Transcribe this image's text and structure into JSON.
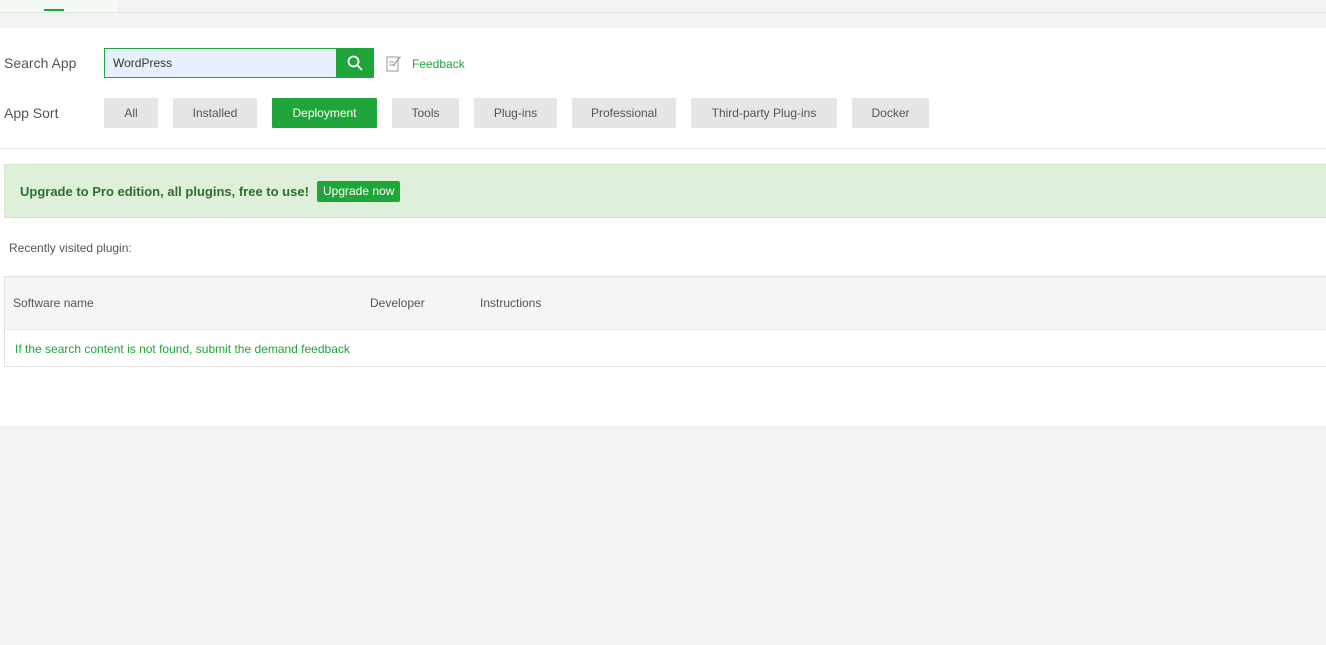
{
  "search": {
    "label": "Search App",
    "value": "WordPress",
    "feedback_label": "Feedback"
  },
  "sort": {
    "label": "App Sort",
    "items": [
      "All",
      "Installed",
      "Deployment",
      "Tools",
      "Plug-ins",
      "Professional",
      "Third-party Plug-ins",
      "Docker"
    ],
    "active": "Deployment"
  },
  "banner": {
    "message": "Upgrade to Pro edition, all plugins, free to use!",
    "button": "Upgrade now"
  },
  "recent": {
    "label": "Recently visited plugin:"
  },
  "table": {
    "columns": [
      "Software name",
      "Developer",
      "Instructions"
    ],
    "empty_message": "If the search content is not found, submit the demand feedback"
  },
  "colors": {
    "accent": "#20a53a",
    "banner_bg": "#def0da",
    "banner_text": "#2f6f2d",
    "page_bg": "#f2f2f2"
  },
  "icons": {
    "search": "search-icon",
    "feedback": "edit-note-icon"
  }
}
